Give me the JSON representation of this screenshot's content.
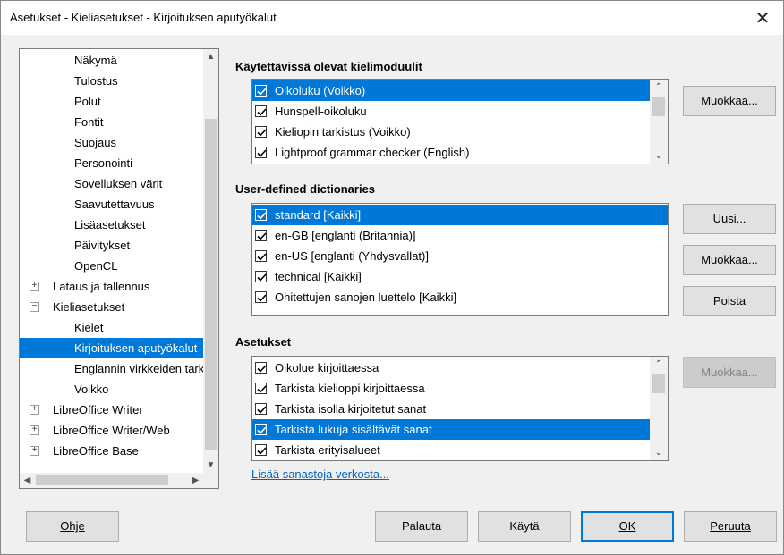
{
  "window": {
    "title": "Asetukset - Kieliasetukset - Kirjoituksen aputyökalut",
    "close_glyph": "✕"
  },
  "tree": {
    "items": [
      {
        "label": "Näkymä",
        "indent": 2
      },
      {
        "label": "Tulostus",
        "indent": 2
      },
      {
        "label": "Polut",
        "indent": 2
      },
      {
        "label": "Fontit",
        "indent": 2
      },
      {
        "label": "Suojaus",
        "indent": 2
      },
      {
        "label": "Personointi",
        "indent": 2
      },
      {
        "label": "Sovelluksen värit",
        "indent": 2
      },
      {
        "label": "Saavutettavuus",
        "indent": 2
      },
      {
        "label": "Lisäasetukset",
        "indent": 2
      },
      {
        "label": "Päivitykset",
        "indent": 2
      },
      {
        "label": "OpenCL",
        "indent": 2
      },
      {
        "label": "Lataus ja tallennus",
        "indent": 1,
        "expander": "+"
      },
      {
        "label": "Kieliasetukset",
        "indent": 1,
        "expander": "−"
      },
      {
        "label": "Kielet",
        "indent": 2
      },
      {
        "label": "Kirjoituksen aputyökalut",
        "indent": 2,
        "selected": true
      },
      {
        "label": "Englannin virkkeiden tarkistus",
        "indent": 2
      },
      {
        "label": "Voikko",
        "indent": 2
      },
      {
        "label": "LibreOffice Writer",
        "indent": 1,
        "expander": "+"
      },
      {
        "label": "LibreOffice Writer/Web",
        "indent": 1,
        "expander": "+"
      },
      {
        "label": "LibreOffice Base",
        "indent": 1,
        "expander": "+"
      }
    ]
  },
  "modules": {
    "heading": "Käytettävissä olevat kielimoduulit",
    "items": [
      {
        "label": "Oikoluku (Voikko)",
        "checked": true,
        "selected": true
      },
      {
        "label": "Hunspell-oikoluku",
        "checked": true
      },
      {
        "label": "Kieliopin tarkistus (Voikko)",
        "checked": true
      },
      {
        "label": "Lightproof grammar checker (English)",
        "checked": true
      }
    ],
    "edit_button": "Muokkaa..."
  },
  "dictionaries": {
    "heading": "User-defined dictionaries",
    "items": [
      {
        "label": "standard [Kaikki]",
        "checked": true,
        "selected": true
      },
      {
        "label": "en-GB [englanti (Britannia)]",
        "checked": true
      },
      {
        "label": "en-US [englanti (Yhdysvallat)]",
        "checked": true
      },
      {
        "label": "technical [Kaikki]",
        "checked": true
      },
      {
        "label": "Ohitettujen sanojen luettelo [Kaikki]",
        "checked": true
      }
    ],
    "new_button": "Uusi...",
    "edit_button": "Muokkaa...",
    "delete_button": "Poista"
  },
  "options": {
    "heading": "Asetukset",
    "items": [
      {
        "label": "Oikolue kirjoittaessa",
        "checked": true
      },
      {
        "label": "Tarkista kielioppi kirjoittaessa",
        "checked": true
      },
      {
        "label": "Tarkista isolla kirjoitetut sanat",
        "checked": true
      },
      {
        "label": "Tarkista lukuja sisältävät sanat",
        "checked": true,
        "selected": true
      },
      {
        "label": "Tarkista erityisalueet",
        "checked": true
      }
    ],
    "edit_button": "Muokkaa...",
    "more_link": "Lisää sanastoja verkosta..."
  },
  "footer": {
    "help": "Ohje",
    "reset": "Palauta",
    "apply": "Käytä",
    "ok": "OK",
    "cancel": "Peruuta"
  },
  "colors": {
    "accent": "#0078d7",
    "link": "#0563c1",
    "dialog_bg": "#f0f0f0"
  }
}
